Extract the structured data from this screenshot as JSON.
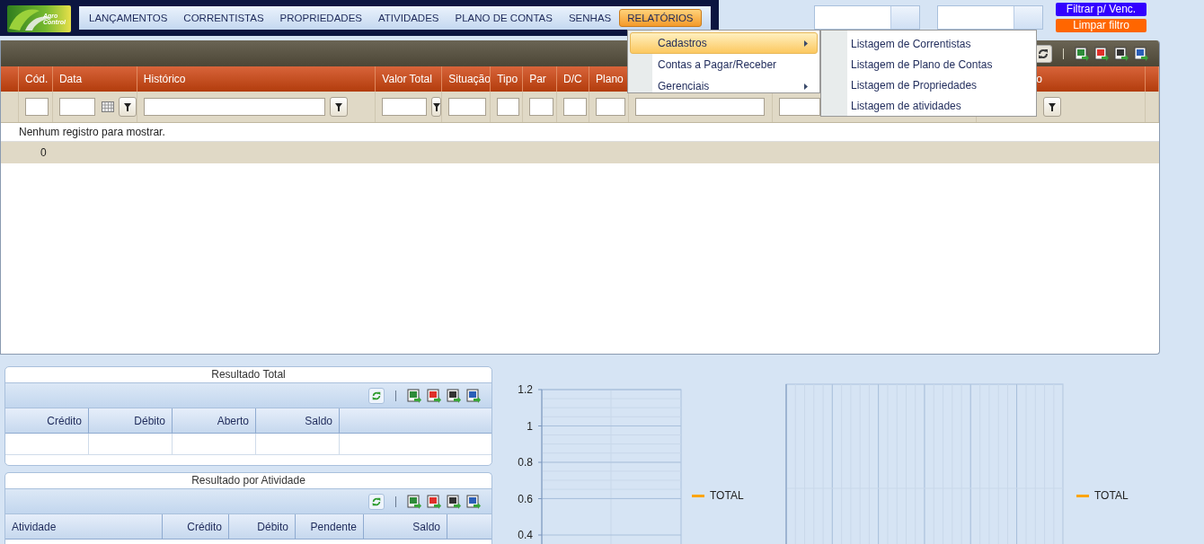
{
  "logo_text": "Agro Control",
  "top_menu": [
    {
      "label": "LANÇAMENTOS",
      "selected": false
    },
    {
      "label": "CORRENTISTAS",
      "selected": false
    },
    {
      "label": "PROPRIEDADES",
      "selected": false
    },
    {
      "label": "ATIVIDADES",
      "selected": false
    },
    {
      "label": "PLANO DE CONTAS",
      "selected": false
    },
    {
      "label": "SENHAS",
      "selected": false
    },
    {
      "label": "RELATÓRIOS",
      "selected": true
    }
  ],
  "buttons": [
    {
      "label": "Filtrar p/ Venc.",
      "color": "#3300ff"
    },
    {
      "label": "Limpar filtro",
      "color": "#ff6600"
    }
  ],
  "dropdown": {
    "items": [
      {
        "label": "Cadastros",
        "selected": true,
        "has_submenu": true
      },
      {
        "label": "Contas a Pagar/Receber",
        "selected": false,
        "has_submenu": false
      },
      {
        "label": "Gerenciais",
        "selected": false,
        "has_submenu": true
      }
    ],
    "submenu": [
      "Listagem de Correntistas",
      "Listagem de Plano de Contas",
      "Listagem de Propriedades",
      "Listagem de atividades"
    ]
  },
  "grid": {
    "columns": [
      "Cód.",
      "Data",
      "Histórico",
      "Valor Total",
      "Situação",
      "Tipo",
      "Par",
      "D/C",
      "Plano"
    ],
    "partial_column_label": "o",
    "empty_message": "Nenhum registro para mostrar.",
    "footer_count": "0"
  },
  "panels": [
    {
      "title": "Resultado Total",
      "columns": [
        "Crédito",
        "Débito",
        "Aberto",
        "Saldo"
      ]
    },
    {
      "title": "Resultado por Atividade",
      "columns": [
        "Atividade",
        "Crédito",
        "Débito",
        "Pendente",
        "Saldo"
      ]
    }
  ],
  "charts": [
    {
      "chart_data": {
        "type": "line",
        "ylim": [
          0.4,
          1.2
        ],
        "yticks": [
          0.4,
          0.6,
          0.8,
          1,
          1.2
        ],
        "grid": true,
        "series": [
          {
            "name": "TOTAL",
            "color": "#ffa500"
          }
        ]
      }
    },
    {
      "legend": [
        {
          "name": "TOTAL",
          "color": "#ffa500"
        }
      ]
    }
  ]
}
